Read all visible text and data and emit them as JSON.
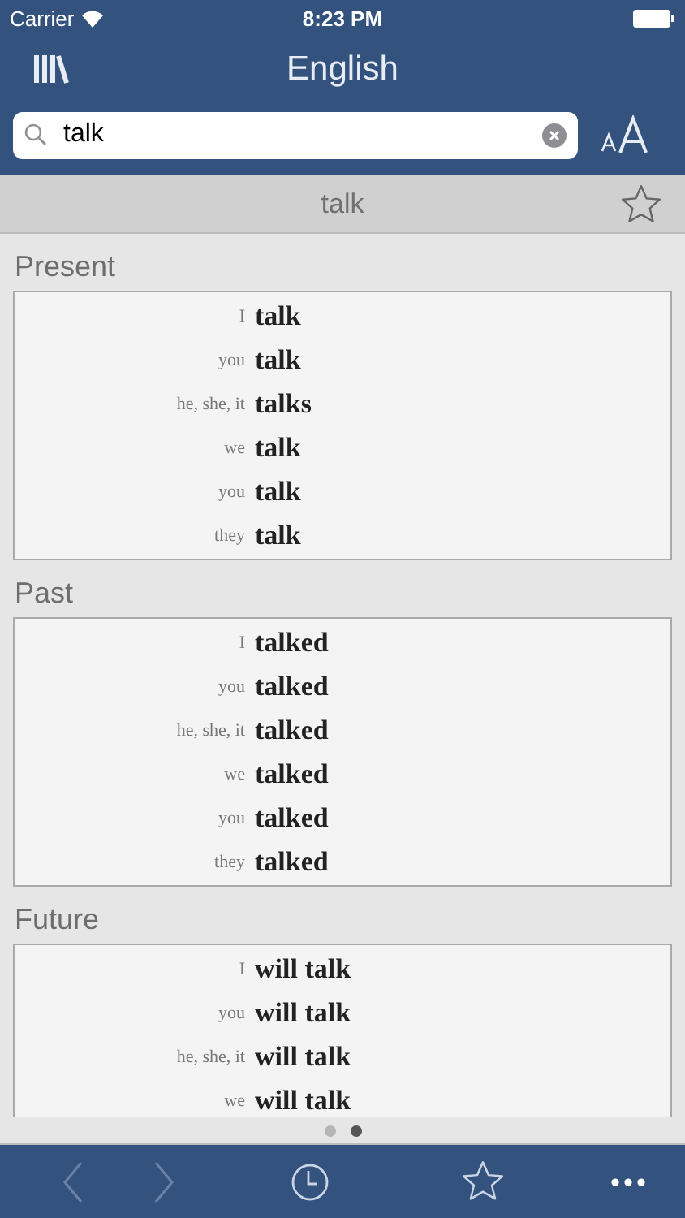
{
  "status_bar": {
    "carrier": "Carrier",
    "time": "8:23 PM"
  },
  "nav": {
    "title": "English"
  },
  "search": {
    "value": "talk"
  },
  "entry": {
    "word": "talk",
    "favorite": false
  },
  "sections": [
    {
      "title": "Present",
      "rows": [
        {
          "pronoun": "I",
          "form": "talk"
        },
        {
          "pronoun": "you",
          "form": "talk"
        },
        {
          "pronoun": "he, she, it",
          "form": "talks"
        },
        {
          "pronoun": "we",
          "form": "talk"
        },
        {
          "pronoun": "you",
          "form": "talk"
        },
        {
          "pronoun": "they",
          "form": "talk"
        }
      ]
    },
    {
      "title": "Past",
      "rows": [
        {
          "pronoun": "I",
          "form": "talked"
        },
        {
          "pronoun": "you",
          "form": "talked"
        },
        {
          "pronoun": "he, she, it",
          "form": "talked"
        },
        {
          "pronoun": "we",
          "form": "talked"
        },
        {
          "pronoun": "you",
          "form": "talked"
        },
        {
          "pronoun": "they",
          "form": "talked"
        }
      ]
    },
    {
      "title": "Future",
      "rows": [
        {
          "pronoun": "I",
          "form": "will talk"
        },
        {
          "pronoun": "you",
          "form": "will talk"
        },
        {
          "pronoun": "he, she, it",
          "form": "will talk"
        },
        {
          "pronoun": "we",
          "form": "will talk"
        }
      ]
    }
  ],
  "pages": [
    {
      "selected": false
    },
    {
      "selected": true
    }
  ],
  "toolbar": {
    "back_disabled": true,
    "forward_disabled": true
  }
}
